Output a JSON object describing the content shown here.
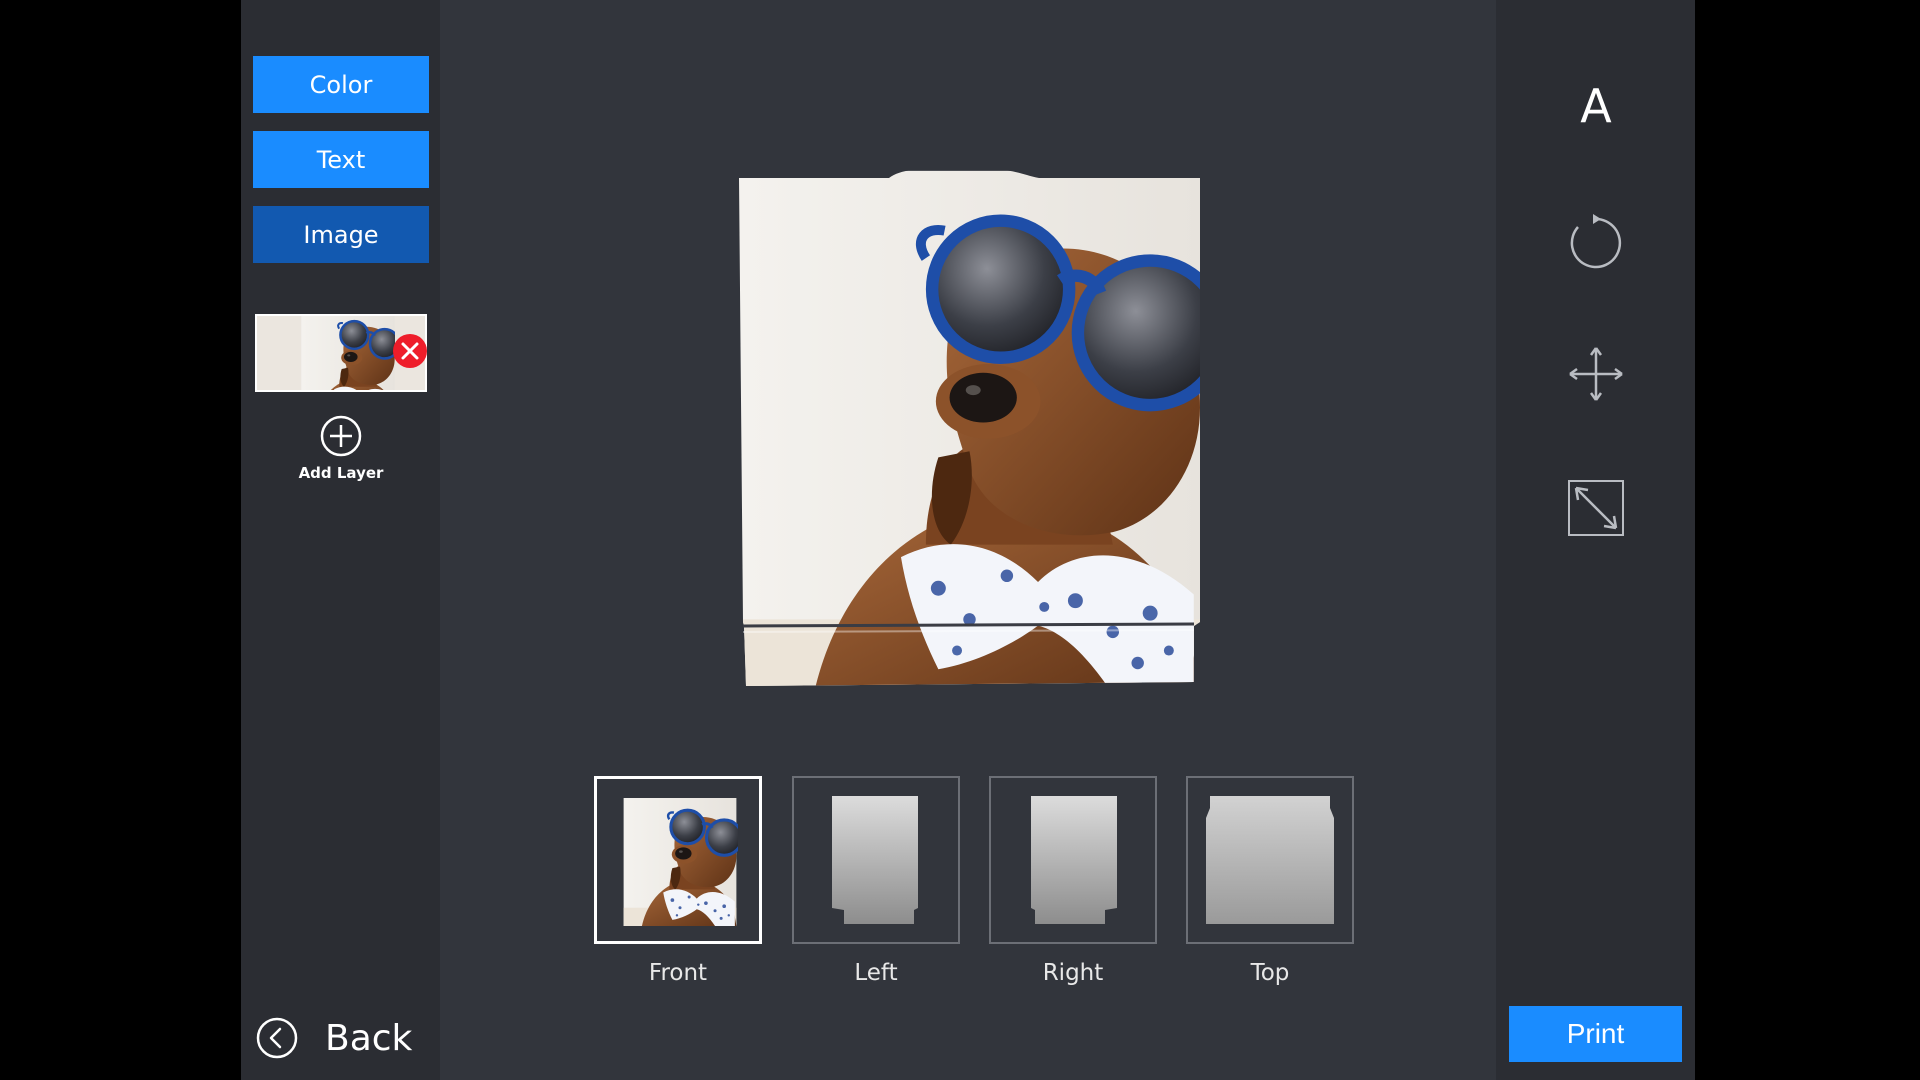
{
  "sidebar": {
    "tools": {
      "color_label": "Color",
      "text_label": "Text",
      "image_label": "Image"
    },
    "layers": [
      {
        "type": "image",
        "selected": true
      }
    ],
    "add_layer_label": "Add Layer",
    "back_label": "Back"
  },
  "views": [
    {
      "label": "Front",
      "active": true
    },
    {
      "label": "Left",
      "active": false
    },
    {
      "label": "Right",
      "active": false
    },
    {
      "label": "Top",
      "active": false
    }
  ],
  "toolbar": {
    "text_tool_glyph": "A",
    "tools": [
      "text-icon",
      "rotate-icon",
      "move-icon",
      "resize-icon"
    ],
    "print_label": "Print"
  },
  "colors": {
    "accent": "#1a8cff",
    "accent_active": "#1259b0",
    "panel": "#2b2d33",
    "canvas": "#32353c",
    "remove": "#ee1d2a"
  }
}
